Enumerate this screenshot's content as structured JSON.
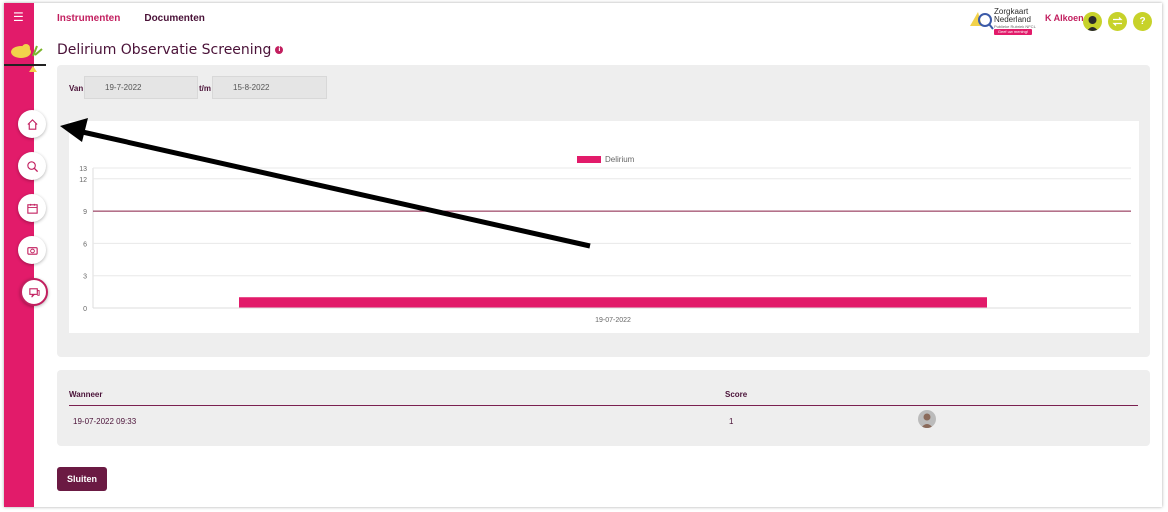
{
  "nav": {
    "instrumenten": "Instrumenten",
    "documenten": "Documenten"
  },
  "brand": {
    "line1": "Zorgkaart",
    "line2": "Nederland",
    "tag": "Publieke Rubriek NFCL",
    "badge": "Geef uw mening!"
  },
  "user": {
    "name": "K Alkoen",
    "swap_icon": "swap-icon",
    "help_label": "?"
  },
  "page": {
    "title": "Delirium Observatie Screening",
    "info_icon": "info-icon"
  },
  "filter": {
    "van_label": "Van",
    "van_value": "19-7-2022",
    "tm_label": "t/m",
    "tm_value": "15-8-2022"
  },
  "chart_data": {
    "type": "bar",
    "orientation": "horizontal-bar-baseline",
    "legend": "Delirium",
    "categories": [
      "19-07-2022"
    ],
    "series": [
      {
        "name": "Delirium",
        "values": [
          1
        ],
        "color": "#e21b6a"
      }
    ],
    "yticks": [
      "13",
      "12",
      "9",
      "6",
      "3",
      "0"
    ],
    "ylim": [
      0,
      13
    ],
    "threshold": 9,
    "grid": true,
    "legend_position": "top-center"
  },
  "table": {
    "headers": [
      "Wanneer",
      "Score"
    ],
    "rows": [
      {
        "wanneer": "19-07-2022 09:33",
        "score": "1"
      }
    ]
  },
  "close_button": "Sluiten",
  "colors": {
    "accent": "#e21b6a",
    "dark": "#6b1a43",
    "lime": "#c7d22a"
  }
}
